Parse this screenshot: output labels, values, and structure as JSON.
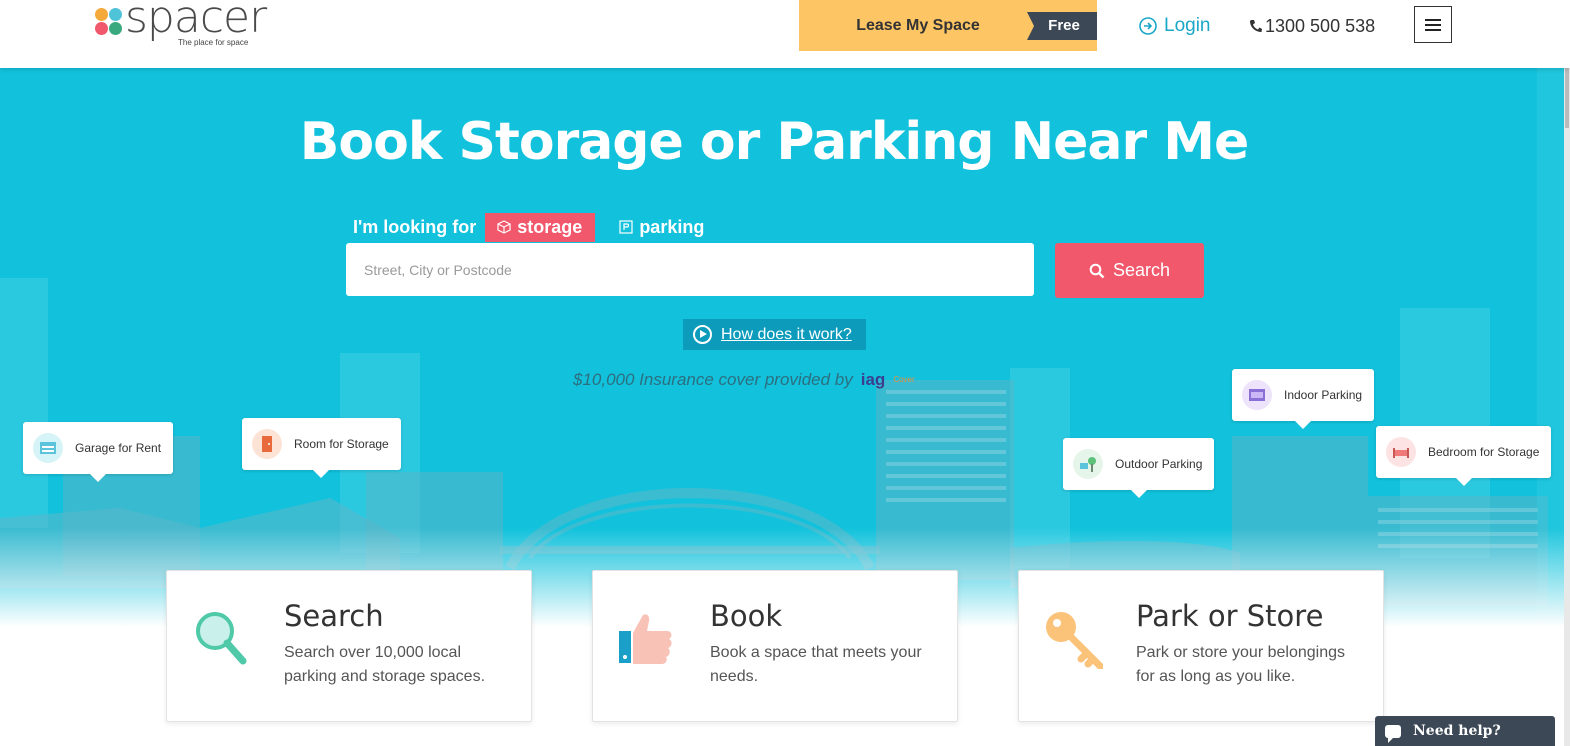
{
  "header": {
    "logo_text": "spacer",
    "logo_tagline": "The place for space",
    "lease_label": "Lease My Space",
    "lease_badge": "Free",
    "login_label": "Login",
    "phone": "1300 500 538"
  },
  "hero": {
    "title": "Book Storage or Parking Near Me",
    "looking_for_label": "I'm looking for",
    "tabs": [
      {
        "label": "storage",
        "active": true
      },
      {
        "label": "parking",
        "active": false
      }
    ],
    "search_placeholder": "Street, City or Postcode",
    "search_value": "",
    "search_button": "Search",
    "how_it_works": "How does it work?",
    "insurance_text": "$10,000 Insurance cover provided by",
    "insurance_logo": "iag",
    "insurance_logo2": "Cover",
    "callouts": [
      {
        "label": "Garage for Rent",
        "icon": "garage-icon"
      },
      {
        "label": "Room for Storage",
        "icon": "door-icon"
      },
      {
        "label": "Outdoor Parking",
        "icon": "tree-icon"
      },
      {
        "label": "Indoor Parking",
        "icon": "car-park-icon"
      },
      {
        "label": "Bedroom for Storage",
        "icon": "bed-icon"
      }
    ]
  },
  "cards": [
    {
      "title": "Search",
      "description": "Search over 10,000 local parking and storage spaces.",
      "icon": "magnifier-icon"
    },
    {
      "title": "Book",
      "description": "Book a space that meets your needs.",
      "icon": "thumbs-up-icon"
    },
    {
      "title": "Park or Store",
      "description": "Park or store your belongings for as long as you like.",
      "icon": "key-icon"
    }
  ],
  "chat": {
    "label": "Need help?"
  },
  "colors": {
    "brand_teal": "#12c2dc",
    "accent_coral": "#f1586b",
    "lease_yellow": "#fdc564",
    "dark_slate": "#3c4855"
  }
}
